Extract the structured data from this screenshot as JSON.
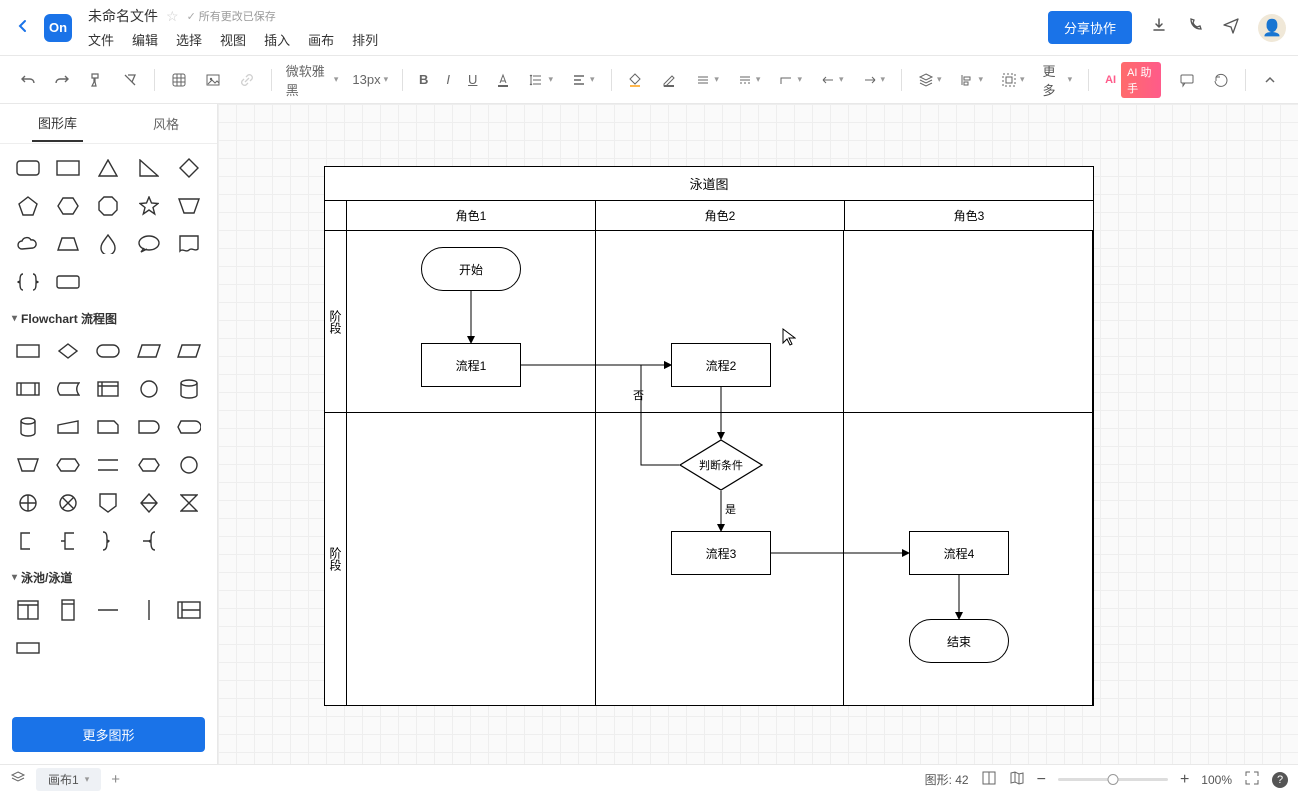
{
  "header": {
    "doc_title": "未命名文件",
    "saved_text": "所有更改已保存",
    "menu": [
      "文件",
      "编辑",
      "选择",
      "视图",
      "插入",
      "画布",
      "排列"
    ],
    "share_label": "分享协作"
  },
  "toolbar": {
    "font_family": "微软雅黑",
    "font_size": "13px",
    "more_label": "更多",
    "ai_label": "AI 助手",
    "ai_prefix": "AI"
  },
  "sidebar": {
    "tabs": {
      "shapes": "图形库",
      "style": "风格"
    },
    "categories": {
      "flowchart": "Flowchart 流程图",
      "swimlane": "泳池/泳道"
    },
    "more_shapes": "更多图形"
  },
  "diagram": {
    "title": "泳道图",
    "roles": [
      "角色1",
      "角色2",
      "角色3"
    ],
    "phases": [
      "阶段",
      "阶段"
    ],
    "nodes": {
      "start": "开始",
      "p1": "流程1",
      "p2": "流程2",
      "decision": "判断条件",
      "p3": "流程3",
      "p4": "流程4",
      "end": "结束"
    },
    "edge_labels": {
      "no": "否",
      "yes": "是"
    }
  },
  "status": {
    "sheet": "画布1",
    "shape_label": "图形:",
    "shape_count": "42",
    "zoom": "100%"
  }
}
